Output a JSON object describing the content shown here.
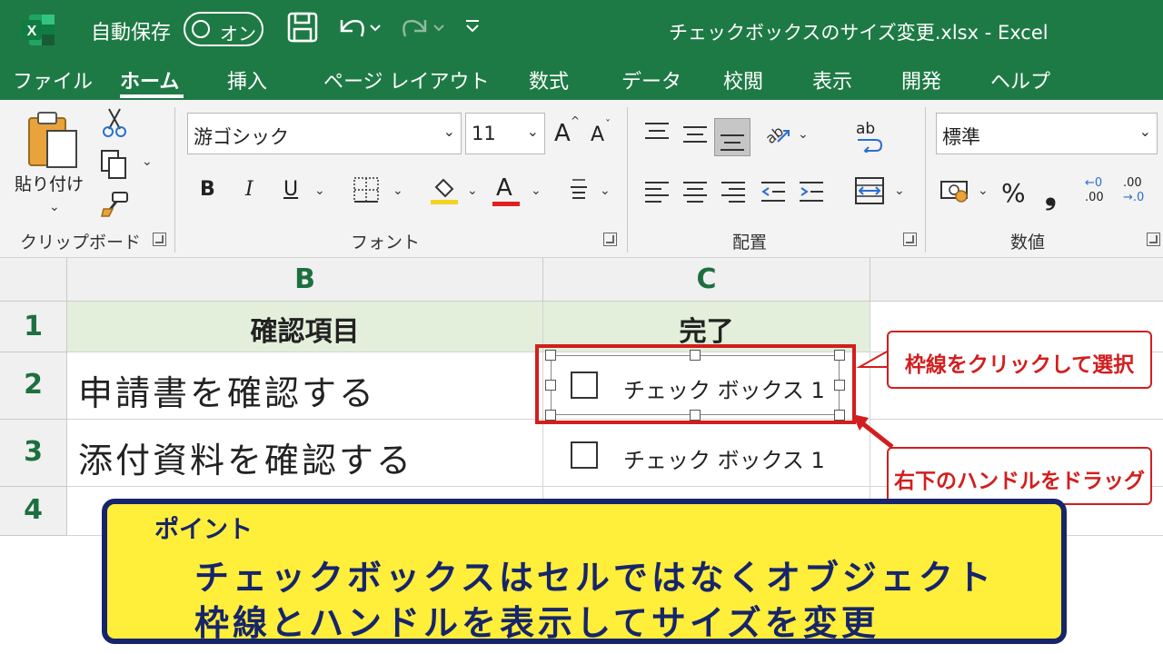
{
  "titlebar": {
    "logo_letter": "X",
    "autosave_label": "自動保存",
    "autosave_state": "オン",
    "doc_title": "チェックボックスのサイズ変更.xlsx  -  Excel"
  },
  "tabs": [
    "ファイル",
    "ホーム",
    "挿入",
    "ページ レイアウト",
    "数式",
    "データ",
    "校閲",
    "表示",
    "開発",
    "ヘルプ"
  ],
  "active_tab": "ホーム",
  "ribbon": {
    "clipboard": {
      "paste_label": "貼り付け",
      "group_label": "クリップボード"
    },
    "font": {
      "font_name": "游ゴシック",
      "font_size": "11",
      "grow": "A",
      "shrink": "A",
      "bold": "B",
      "italic": "I",
      "underline": "U",
      "font_color_glyph": "A",
      "group_label": "フォント"
    },
    "alignment": {
      "wrap_glyph": "ab",
      "group_label": "配置"
    },
    "number": {
      "format": "標準",
      "percent": "%",
      "comma": "❟",
      "inc_decimal_top": "←0",
      "inc_decimal_bottom": ".00",
      "dec_decimal_top": ".00",
      "dec_decimal_bottom": "→.0",
      "group_label": "数値"
    },
    "colors": {
      "highlight": "#f4d21e",
      "font_color": "#e0201e"
    }
  },
  "grid": {
    "columns": [
      "B",
      "C"
    ],
    "rows": [
      "1",
      "2",
      "3",
      "4"
    ],
    "header_row": {
      "b": "確認項目",
      "c": "完了"
    },
    "row2": {
      "b": "申請書を確認する",
      "checkbox_label": "チェック ボックス 1"
    },
    "row3": {
      "b": "添付資料を確認する",
      "checkbox_label": "チェック ボックス 1"
    }
  },
  "callouts": {
    "select": "枠線をクリックして選択",
    "drag": "右下のハンドルをドラッグ"
  },
  "point": {
    "title": "ポイント",
    "line1": "チェックボックスはセルではなくオブジェクト",
    "line2": "枠線とハンドルを表示してサイズを変更"
  },
  "theme": {
    "excel_green": "#1e7a45",
    "accent_red": "#d21e1e",
    "point_bg": "#ffee3a",
    "point_border": "#16256b"
  }
}
